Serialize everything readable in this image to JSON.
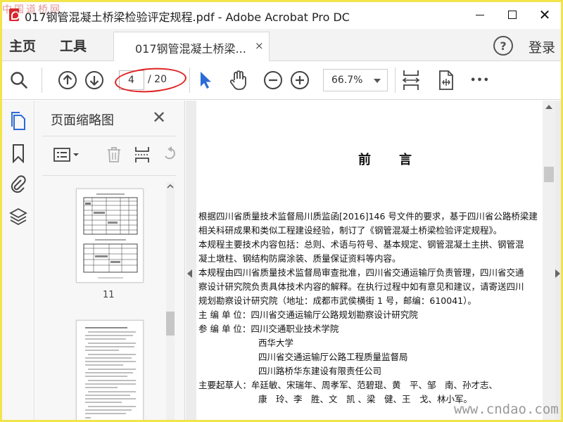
{
  "window": {
    "title": "017钢管混凝土桥梁检验评定规程.pdf - Adobe Acrobat Pro DC",
    "watermark_top": "中国道桥网",
    "minimize_glyph": "—",
    "maximize_glyph": "☐",
    "close_glyph": "✕"
  },
  "tabs": {
    "home": "主页",
    "tools": "工具",
    "document": "017钢管混凝土桥梁...",
    "document_close": "×",
    "help": "?",
    "login": "登录"
  },
  "toolbar": {
    "icons": [
      "search-icon",
      "page-up-icon",
      "page-down-icon",
      "select-arrow-icon",
      "hand-icon",
      "zoom-out-icon",
      "zoom-in-icon",
      "fit-width-icon",
      "rotate-page-icon",
      "more-icon"
    ],
    "current_page": "4",
    "total_pages": "/ 20",
    "zoom": "66.7%",
    "more": "•••"
  },
  "left_rail": {
    "icons": [
      "page-thumbnails-icon",
      "bookmark-icon",
      "attachment-icon",
      "layers-icon"
    ]
  },
  "thumbnail_panel": {
    "title": "页面缩略图",
    "close": "✕",
    "tools": [
      "options-menu-icon",
      "delete-icon",
      "page-extract-icon",
      "undo-icon"
    ],
    "thumbnails": [
      {
        "label": "11"
      },
      {
        "label": ""
      }
    ]
  },
  "document": {
    "heading": "前言",
    "lines": [
      "根据四川省质量技术监督局川质监函[2016]146 号文件的要求，基于四川省公路桥梁建",
      "相关科研成果和类似工程建设经验，制订了《钢管混凝土桥梁检验评定规程》。",
      "本规程主要技术内容包括：总则、术语与符号、基本规定、钢管混凝土主拱、钢管混",
      "凝土墩柱、钢结构防腐涂装、质量保证资料等内容。",
      "本规程由四川省质量技术监督局审查批准，四川省交通运输厅负责管理，四川省交通",
      "察设计研究院负责具体技术内容的解释。在执行过程中如有意见和建议，请寄送四川",
      "规划勘察设计研究院（地址：成都市武侯横街 1 号，邮编：610041）。",
      "主 编 单 位：四川省交通运输厅公路规划勘察设计研究院",
      "参 编 单 位：四川交通职业技术学院"
    ],
    "indented_lines": [
      "西华大学",
      "四川省交通运输厅公路工程质量监督局",
      "四川路桥华东建设有限责任公司"
    ],
    "drafters_line1": "主要起草人：牟廷敏、宋瑞年、周孝军、范碧琨、黄　平、邹　南、孙才志、",
    "drafters_line2": "康　玲、李　胜、文　凯 、梁　健、王　戈、林小军。"
  },
  "footer": {
    "watermark": "www.cndao.com"
  },
  "colors": {
    "accent_blue": "#2d6bd6",
    "annotation_red": "#e02020",
    "frame_yellow": "#f2e44a"
  }
}
